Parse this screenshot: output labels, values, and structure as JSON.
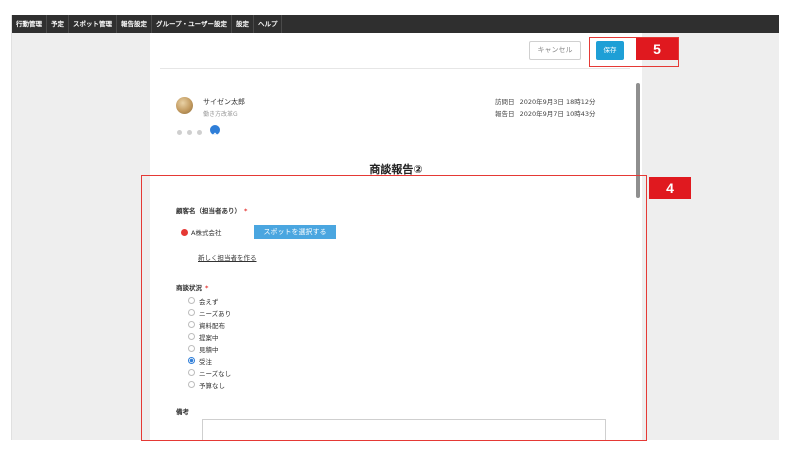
{
  "nav": {
    "items": [
      "行動管理",
      "予定",
      "スポット管理",
      "報告設定",
      "グループ・ユーザー設定",
      "設定",
      "ヘルプ"
    ]
  },
  "toolbar": {
    "cancel_label": "キャンセル",
    "save_label": "保存"
  },
  "report": {
    "author_name": "サイゼン太郎",
    "author_dept": "働き方改革G",
    "visit_date_label": "訪問日",
    "visit_date": "2020年9月3日 18時12分",
    "report_date_label": "報告日",
    "report_date": "2020年9月7日 10時43分",
    "title": "商談報告②"
  },
  "form": {
    "customer": {
      "label": "顧客名（担当者あり）",
      "required_mark": "*",
      "selected": "A株式会社",
      "spot_button": "スポットを選択する",
      "new_contact_link": "新しく担当者を作る"
    },
    "status": {
      "label": "商談状況",
      "required_mark": "*",
      "options": [
        "会えず",
        "ニーズあり",
        "資料配布",
        "提案中",
        "見積中",
        "受注",
        "ニーズなし",
        "予算なし"
      ],
      "selected": "受注"
    },
    "notes": {
      "label": "備考",
      "value": ""
    }
  },
  "annotations": {
    "callout_4": "4",
    "callout_5": "5"
  },
  "colors": {
    "nav_bg": "#2f2f2f",
    "accent": "#1e9fd6",
    "spot_button": "#4aa6e0",
    "highlight": "#e0191f"
  }
}
